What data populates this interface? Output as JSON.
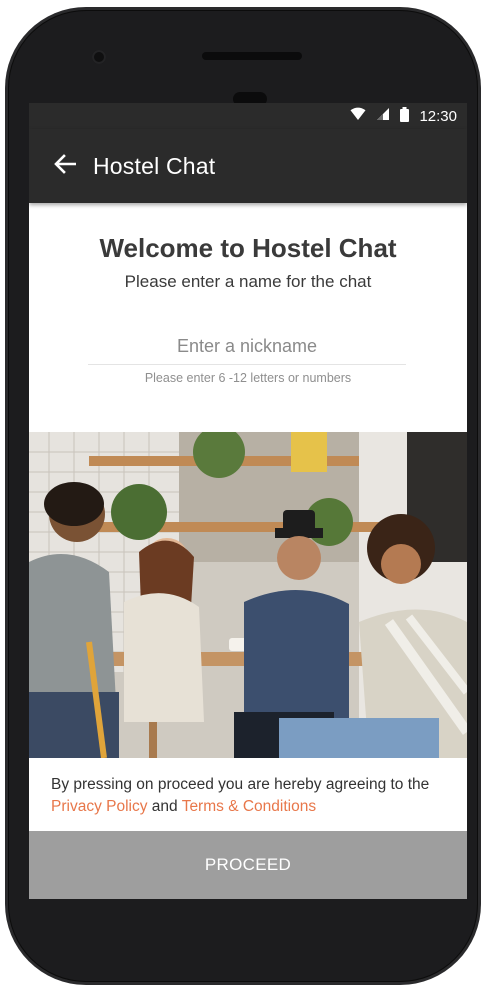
{
  "status_bar": {
    "time": "12:30",
    "icons": [
      "wifi-icon",
      "signal-icon",
      "battery-icon"
    ]
  },
  "app_bar": {
    "back_icon": "arrow-left-icon",
    "title": "Hostel Chat"
  },
  "welcome": {
    "title": "Welcome to Hostel Chat",
    "subtitle": "Please enter a name for the chat"
  },
  "nickname": {
    "value": "",
    "placeholder": "Enter a nickname",
    "hint": "Please enter 6 -12 letters or numbers"
  },
  "consent": {
    "prefix": "By  pressing on proceed you are hereby agreeing to the",
    "privacy_link": "Privacy Policy",
    "joiner": "and",
    "terms_link": "Terms & Conditions"
  },
  "proceed_button": {
    "label": "PROCEED"
  },
  "colors": {
    "app_bar": "#2b2b2b",
    "link": "#e8774a",
    "button": "#9e9e9e",
    "title_text": "#3a3a3a"
  }
}
